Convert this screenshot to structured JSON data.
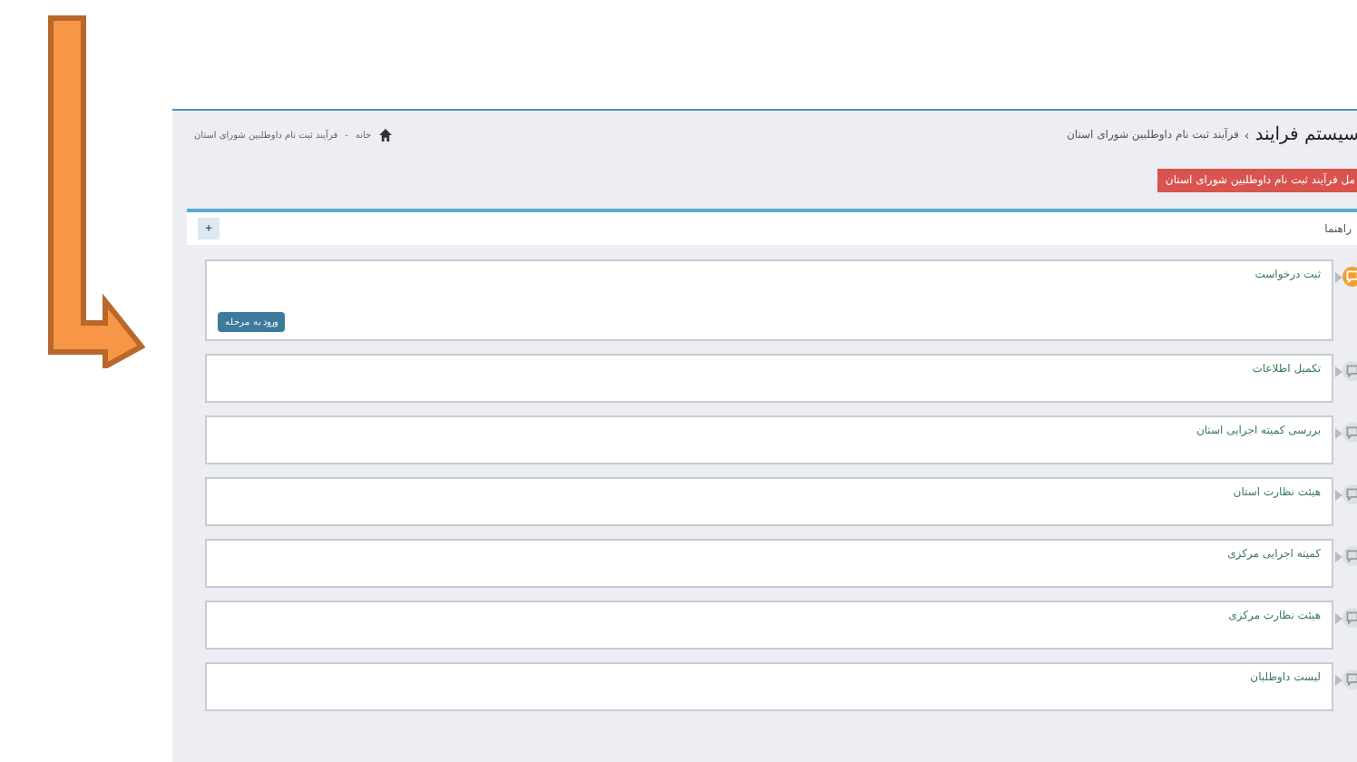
{
  "header": {
    "title": "سیستم فرایند",
    "separator": "›",
    "breadcrumb_current": "فرآیند ثبت نام داوطلبین شورای استان",
    "nav_separator": "-",
    "nav": [
      "خانه",
      "فرآیند ثبت نام داوطلبین شورای استان"
    ]
  },
  "alert": "مل فرآیند ثبت نام داوطلبین شورای استان",
  "help": {
    "label": "راهنما",
    "toggle": "+"
  },
  "steps": [
    {
      "title": "ثبت درخواست",
      "active": true,
      "button": "ورود به مرحله"
    },
    {
      "title": "تکمیل اطلاعات",
      "active": false
    },
    {
      "title": "بررسی کمیته اجرایی استان",
      "active": false
    },
    {
      "title": "هیئت نظارت استان",
      "active": false
    },
    {
      "title": "کمیته اجرایی مرکزی",
      "active": false
    },
    {
      "title": "هیئت نظارت مرکزی",
      "active": false
    },
    {
      "title": "لیست داوطلبان",
      "active": false
    }
  ]
}
